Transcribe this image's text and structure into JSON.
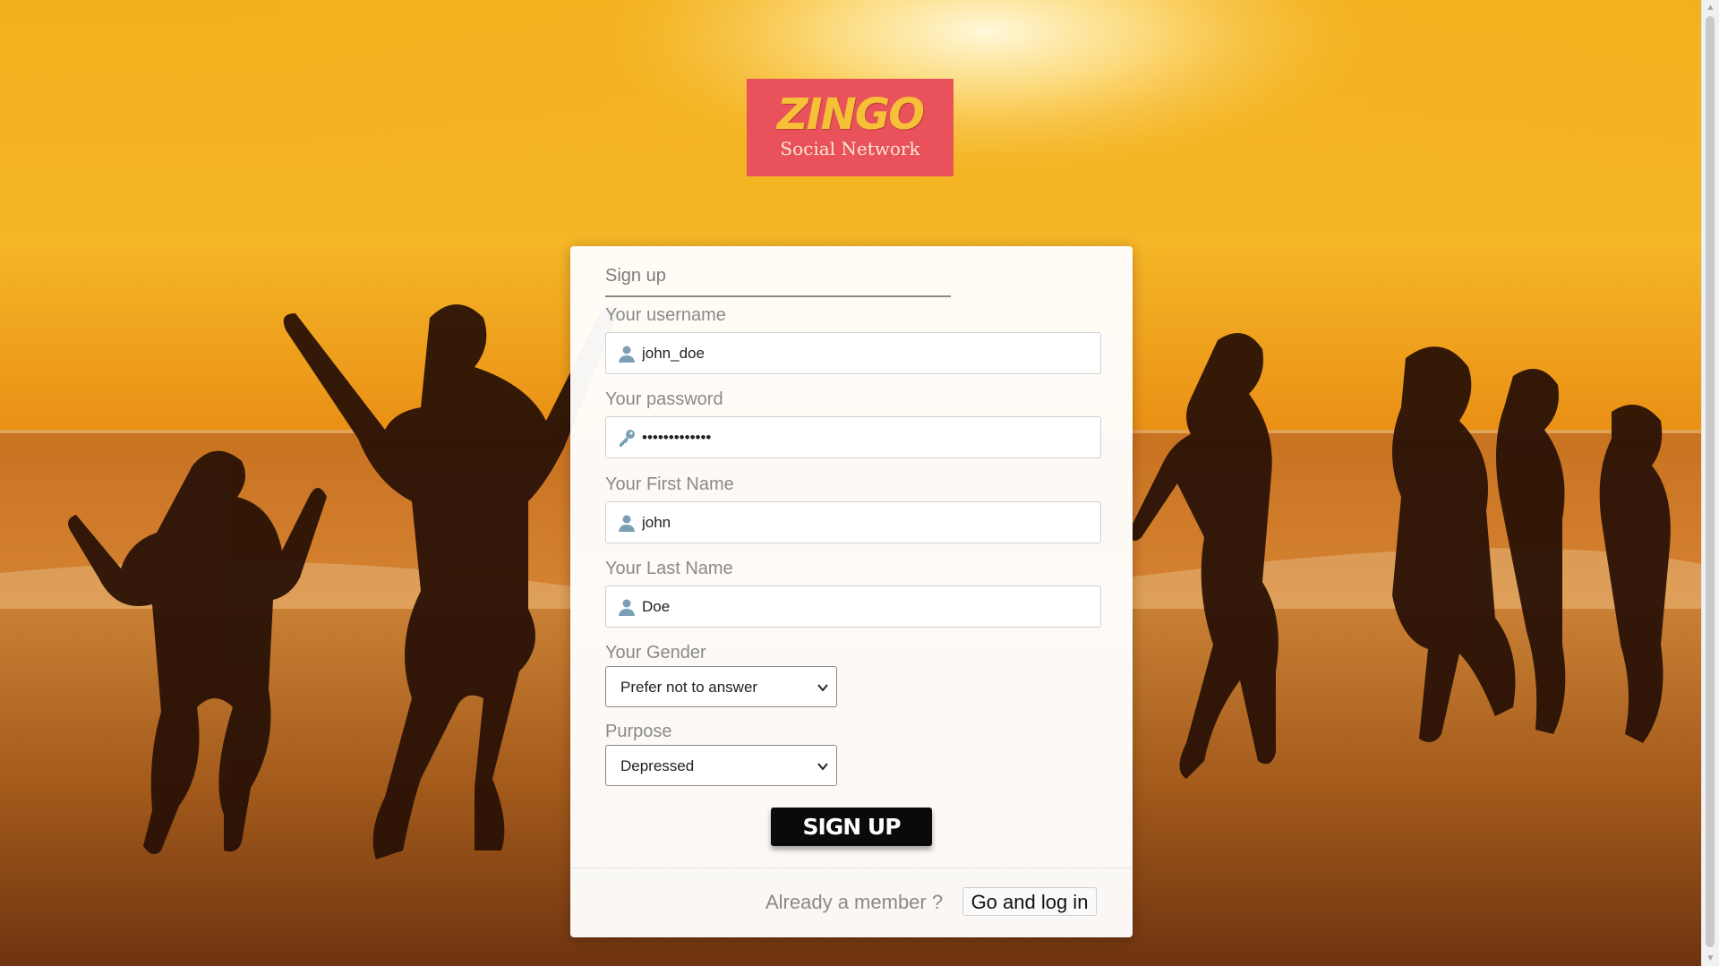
{
  "logo": {
    "main": "ZINGO",
    "sub": "Social Network"
  },
  "form": {
    "title": "Sign up",
    "username": {
      "label": "Your username",
      "value": "john_doe",
      "icon": "user-icon"
    },
    "password": {
      "label": "Your password",
      "value": "•••••••••••••",
      "icon": "key-icon"
    },
    "first_name": {
      "label": "Your First Name",
      "value": "john",
      "icon": "user-icon"
    },
    "last_name": {
      "label": "Your Last Name",
      "value": "Doe",
      "icon": "user-icon"
    },
    "gender": {
      "label": "Your Gender",
      "selected": "Prefer not to answer"
    },
    "purpose": {
      "label": "Purpose",
      "selected": "Depressed"
    },
    "submit_label": "Sign up",
    "member_text": "Already a member ?",
    "login_label": "Go and log in"
  },
  "colors": {
    "logo_bg": "#e9525a",
    "logo_text": "#f6c037",
    "button_bg": "#0a0a0a",
    "label_text": "#8a8a8a",
    "icon": "#4a90b8"
  }
}
